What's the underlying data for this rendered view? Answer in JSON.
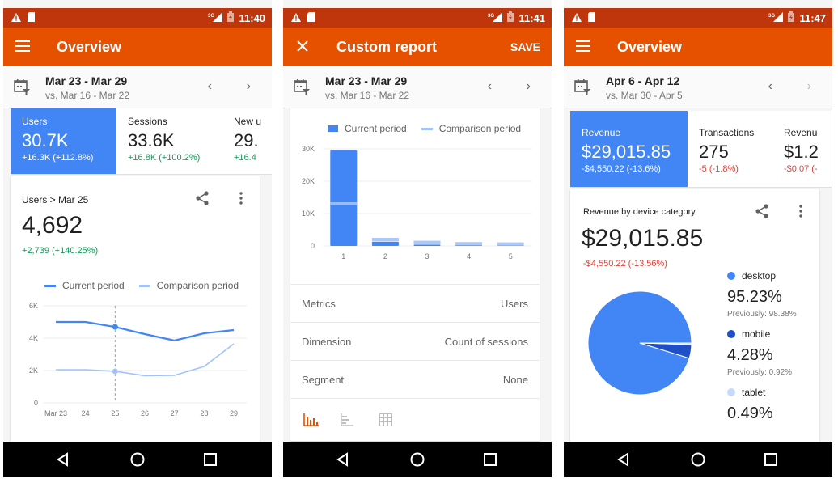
{
  "colors": {
    "status_bar": "#bf360c",
    "app_bar": "#e65100",
    "accent_blue": "#4285f4",
    "comparison_blue": "#a1c2fa",
    "dark_blue": "#1e4fc7",
    "light_blue": "#c6dafc",
    "positive": "#0f9d58",
    "negative": "#db4437"
  },
  "screens": [
    {
      "status": {
        "time": "11:40",
        "network": "3G",
        "left_icons": [
          "warning-icon",
          "sd-card-icon"
        ]
      },
      "appbar": {
        "nav_icon": "menu-icon",
        "title": "Overview"
      },
      "datebar": {
        "range": "Mar 23 - Mar 29",
        "compare": "vs. Mar 16 - Mar 22",
        "prev": "‹",
        "next": "›"
      },
      "kpis": [
        {
          "label": "Users",
          "value": "30.7K",
          "delta": "+16.3K (+112.8%)",
          "trend": "positive",
          "active": true
        },
        {
          "label": "Sessions",
          "value": "33.6K",
          "delta": "+16.8K (+100.2%)",
          "trend": "positive",
          "active": false
        },
        {
          "label": "New u",
          "value": "29.",
          "delta": "+16.4",
          "trend": "positive",
          "active": false
        }
      ],
      "detail": {
        "breadcrumb": "Users > Mar 25",
        "value": "4,692",
        "delta": "+2,739 (+140.25%)"
      }
    },
    {
      "status": {
        "time": "11:41",
        "network": "3G",
        "left_icons": [
          "warning-icon",
          "sd-card-icon"
        ]
      },
      "appbar": {
        "nav_icon": "close-icon",
        "title": "Custom report",
        "action": "SAVE"
      },
      "datebar": {
        "range": "Mar 23 - Mar 29",
        "compare": "vs. Mar 16 - Mar 22",
        "prev": "‹",
        "next": "›"
      },
      "settings": [
        {
          "key": "Metrics",
          "value": "Users"
        },
        {
          "key": "Dimension",
          "value": "Count of sessions"
        },
        {
          "key": "Segment",
          "value": "None"
        }
      ],
      "chart_types": [
        "column-chart-icon",
        "bar-chart-icon",
        "table-icon"
      ],
      "selected_chart_type": "column-chart-icon"
    },
    {
      "status": {
        "time": "11:47",
        "network": "3G",
        "left_icons": [
          "warning-icon",
          "sd-card-icon"
        ]
      },
      "appbar": {
        "nav_icon": "menu-icon",
        "title": "Overview"
      },
      "datebar": {
        "range": "Apr 6 - Apr 12",
        "compare": "vs. Mar 30 - Apr 5",
        "prev": "‹",
        "next": "›"
      },
      "kpis": [
        {
          "label": "Revenue",
          "value": "$29,015.85",
          "delta": "-$4,550.22 (-13.6%)",
          "trend": "negative",
          "active": true
        },
        {
          "label": "Transactions",
          "value": "275",
          "delta": "-5 (-1.8%)",
          "trend": "negative",
          "active": false
        },
        {
          "label": "Revenue",
          "value": "$1.2",
          "delta": "-$0.07 (-",
          "trend": "negative",
          "active": false
        }
      ],
      "detail": {
        "title": "Revenue by device category",
        "value": "$29,015.85",
        "delta": "-$4,550.22 (-13.56%)"
      }
    }
  ],
  "chart_data": [
    {
      "type": "line",
      "title": "Users",
      "x": [
        "Mar 23",
        "24",
        "25",
        "26",
        "27",
        "28",
        "29"
      ],
      "series": [
        {
          "name": "Current period",
          "values": [
            5000,
            5000,
            4692,
            4250,
            3850,
            4300,
            4500
          ]
        },
        {
          "name": "Comparison period",
          "values": [
            2050,
            2050,
            1953,
            1680,
            1700,
            2250,
            3650
          ]
        }
      ],
      "ylim": [
        0,
        6000
      ],
      "yticks": [
        "0",
        "2K",
        "4K",
        "6K"
      ],
      "highlight_index": 2,
      "legend": "top",
      "grid": true
    },
    {
      "type": "bar",
      "categories": [
        "1",
        "2",
        "3",
        "4",
        "5"
      ],
      "series": [
        {
          "name": "Current period",
          "values": [
            29500,
            1300,
            400,
            200,
            100
          ]
        },
        {
          "name": "Comparison period",
          "values": [
            13000,
            2000,
            1100,
            700,
            600
          ]
        }
      ],
      "ylim": [
        0,
        30000
      ],
      "yticks": [
        "0",
        "10K",
        "20K",
        "30K"
      ],
      "legend": "top",
      "grid": true
    },
    {
      "type": "pie",
      "title": "Revenue by device category",
      "slices": [
        {
          "label": "desktop",
          "value": 95.23,
          "display": "95.23%",
          "previous": "Previously: 98.38%",
          "color": "#4285f4"
        },
        {
          "label": "mobile",
          "value": 4.28,
          "display": "4.28%",
          "previous": "Previously: 0.92%",
          "color": "#1e4fc7"
        },
        {
          "label": "tablet",
          "value": 0.49,
          "display": "0.49%",
          "previous": "",
          "color": "#c6dafc"
        }
      ]
    }
  ]
}
